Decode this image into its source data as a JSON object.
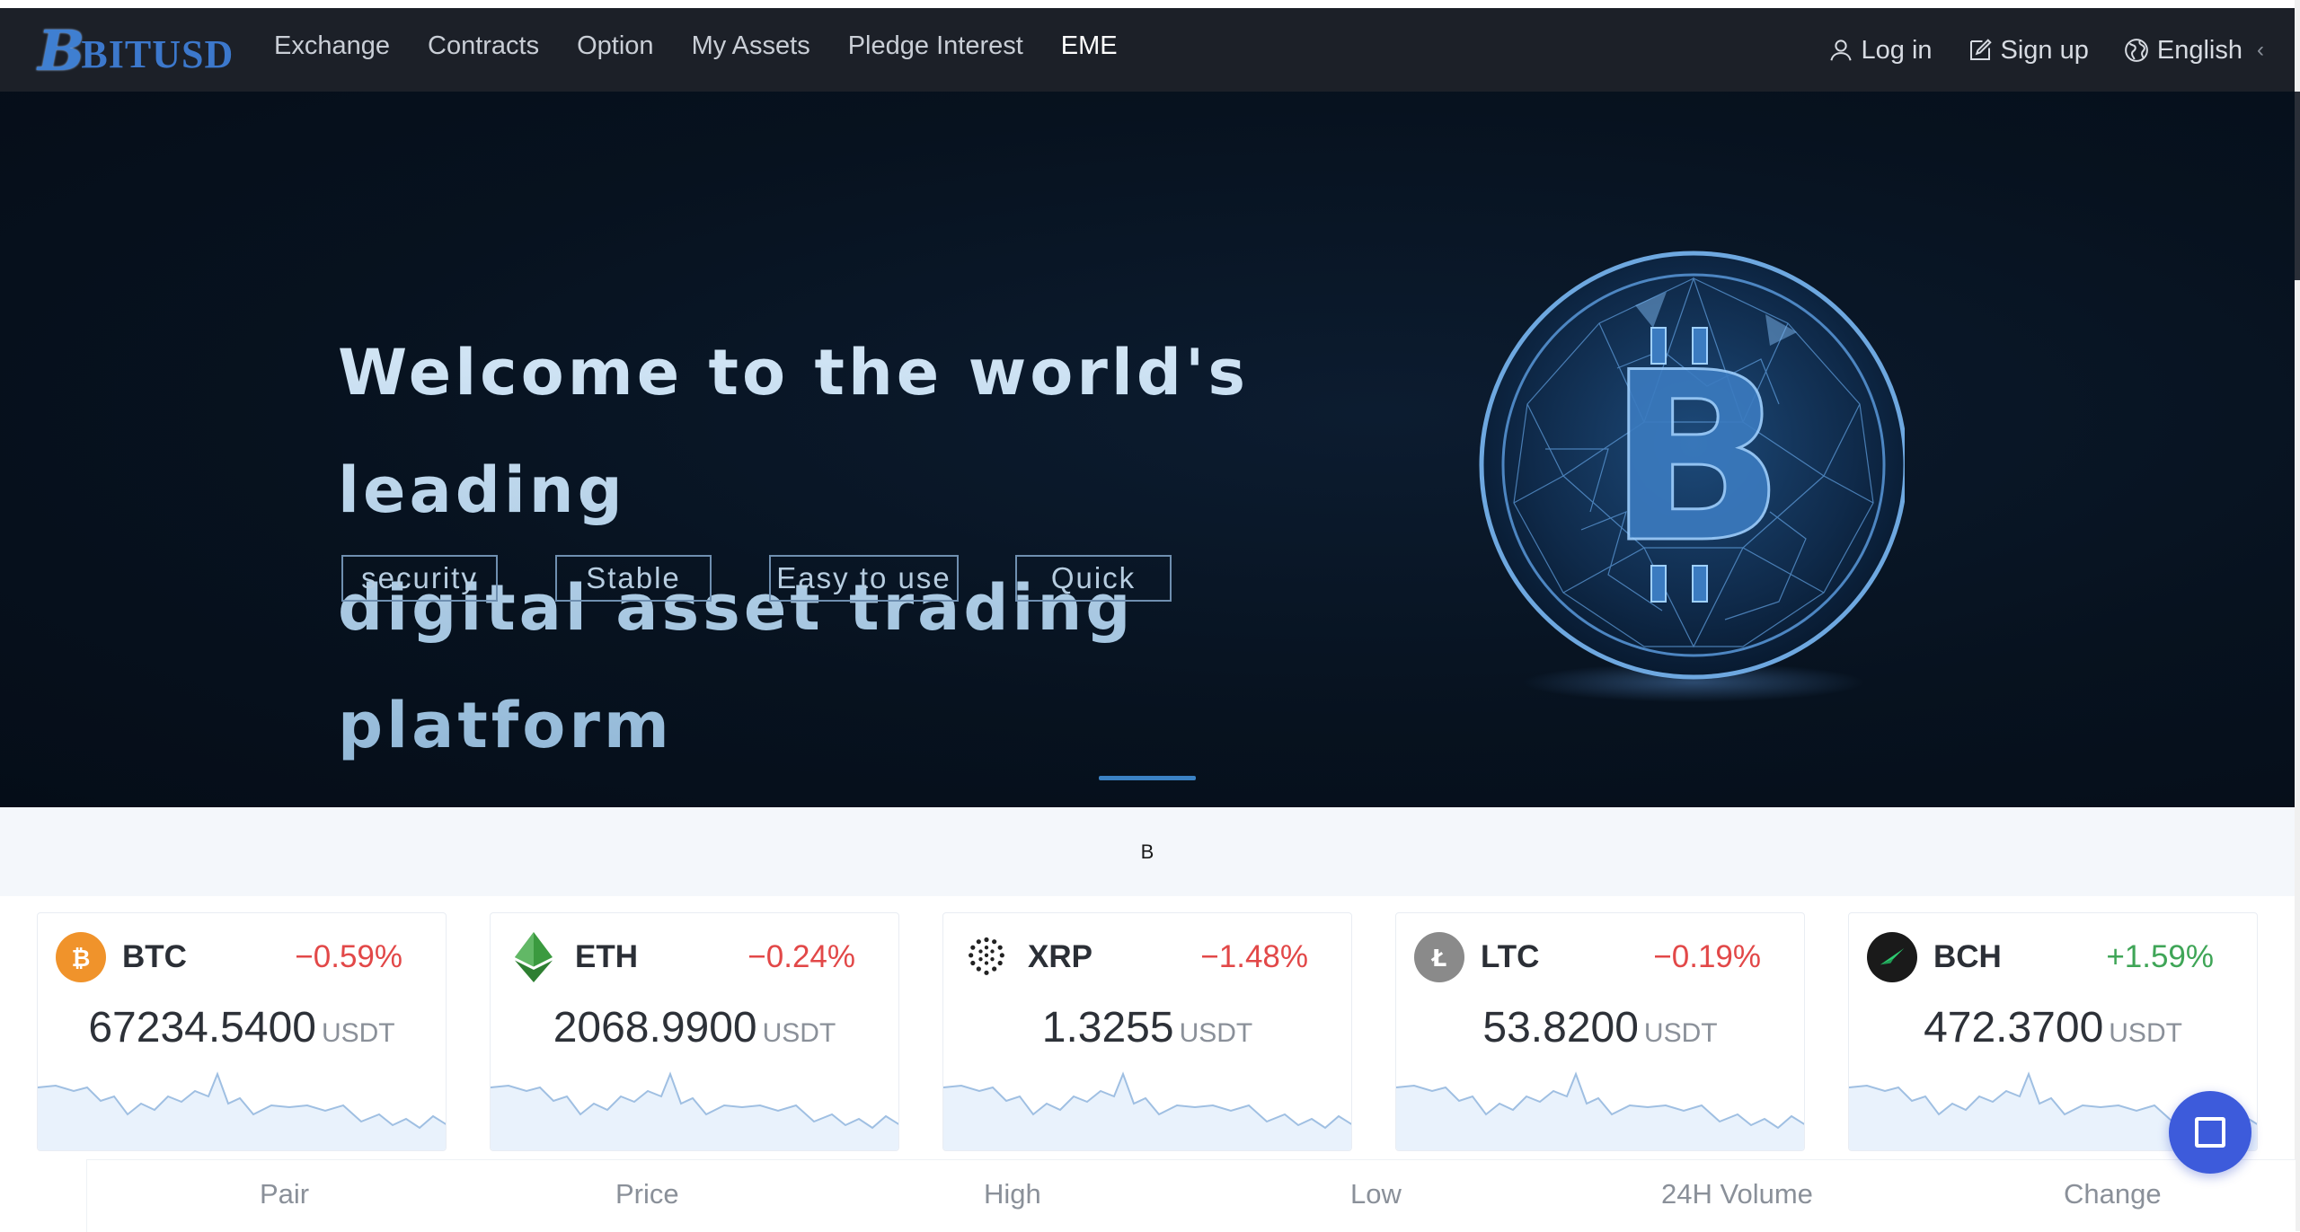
{
  "brand": {
    "mark": "B",
    "name": "BITUSD"
  },
  "nav": {
    "links": [
      "Exchange",
      "Contracts",
      "Option",
      "My Assets",
      "Pledge Interest",
      "EME"
    ],
    "login": "Log in",
    "signup": "Sign up",
    "language": "English",
    "language_caret": "‹"
  },
  "hero": {
    "title_line1": "Welcome to the world's leading",
    "title_line2": "digital asset trading platform",
    "tags": [
      "security",
      "Stable",
      "Easy to use",
      "Quick"
    ],
    "coin_symbol": "B"
  },
  "notice": {
    "text": "B"
  },
  "tickers": [
    {
      "symbol": "BTC",
      "change": "−0.59%",
      "price": "67234.5400",
      "unit": "USDT",
      "icon": "btc-icon",
      "color": "#f0932b"
    },
    {
      "symbol": "ETH",
      "change": "−0.24%",
      "price": "2068.9900",
      "unit": "USDT",
      "icon": "eth-icon",
      "color": "#3b9a3f"
    },
    {
      "symbol": "XRP",
      "change": "−1.48%",
      "price": "1.3255",
      "unit": "USDT",
      "icon": "xrp-icon",
      "color": "#222222"
    },
    {
      "symbol": "LTC",
      "change": "−0.19%",
      "price": "53.8200",
      "unit": "USDT",
      "icon": "ltc-icon",
      "color": "#8a8a8a"
    },
    {
      "symbol": "BCH",
      "change": "+1.59%",
      "price": "472.3700",
      "unit": "USDT",
      "icon": "bch-icon",
      "color": "#1a1a1a"
    }
  ],
  "table": {
    "headers": [
      "Pair",
      "Price",
      "High",
      "Low",
      "24H Volume",
      "Change"
    ]
  },
  "colors": {
    "negative": "#e24848",
    "positive": "#3fa557",
    "accent": "#3d5bdb"
  }
}
